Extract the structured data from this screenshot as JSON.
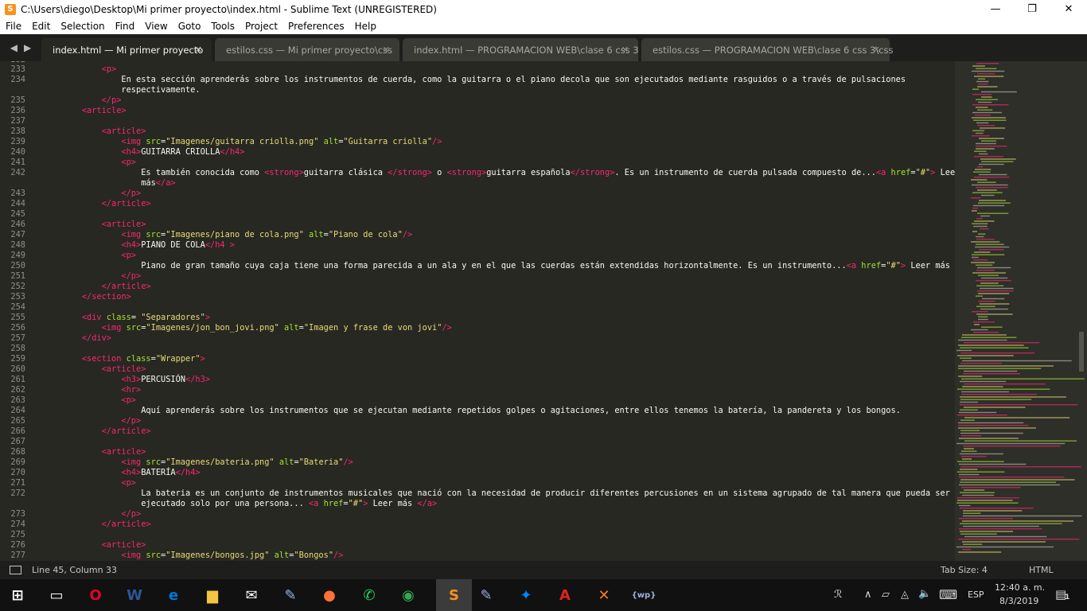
{
  "window": {
    "title": "C:\\Users\\diego\\Desktop\\Mi primer proyecto\\index.html - Sublime Text (UNREGISTERED)",
    "app_icon": "S",
    "minimize_glyph": "—",
    "maximize_glyph": "❐",
    "close_glyph": "✕"
  },
  "menu": [
    "File",
    "Edit",
    "Selection",
    "Find",
    "View",
    "Goto",
    "Tools",
    "Project",
    "Preferences",
    "Help"
  ],
  "nav": {
    "back": "◀",
    "forward": "▶"
  },
  "tabs": [
    {
      "label": "index.html — Mi primer proyecto",
      "active": true
    },
    {
      "label": "estilos.css — Mi primer proyecto\\css",
      "active": false
    },
    {
      "label": "index.html — PROGRAMACION  WEB\\clase 6 css 3",
      "active": false
    },
    {
      "label": "estilos.css — PROGRAMACION  WEB\\clase 6 css 3\\css",
      "active": false
    }
  ],
  "tab_close": "✕",
  "editor": {
    "first_partial_line": "232",
    "lines": [
      {
        "n": "233",
        "segs": [
          {
            "t": "        "
          },
          {
            "t": "<",
            "c": "t"
          },
          {
            "t": "p",
            "c": "t"
          },
          {
            "t": ">",
            "c": "t"
          }
        ]
      },
      {
        "n": "234",
        "segs": [
          {
            "t": "            En esta sección aprenderás sobre los instrumentos de cuerda, como la guitarra o el piano decola que son ejecutados mediante rasguidos o a través de pulsaciones"
          }
        ]
      },
      {
        "n": "",
        "segs": [
          {
            "t": "            respectivamente."
          }
        ]
      },
      {
        "n": "235",
        "segs": [
          {
            "t": "        "
          },
          {
            "t": "</p>",
            "c": "t"
          }
        ]
      },
      {
        "n": "236",
        "segs": [
          {
            "t": "    "
          },
          {
            "t": "<article>",
            "c": "t"
          }
        ]
      },
      {
        "n": "237",
        "segs": [
          {
            "t": ""
          }
        ]
      },
      {
        "n": "238",
        "segs": [
          {
            "t": "        "
          },
          {
            "t": "<article>",
            "c": "t"
          }
        ]
      },
      {
        "n": "239",
        "segs": [
          {
            "t": "            "
          },
          {
            "t": "<img",
            "c": "t"
          },
          {
            "t": " "
          },
          {
            "t": "src",
            "c": "a"
          },
          {
            "t": "="
          },
          {
            "t": "\"Imagenes/guitarra criolla.png\"",
            "c": "s"
          },
          {
            "t": " "
          },
          {
            "t": "alt",
            "c": "a"
          },
          {
            "t": "="
          },
          {
            "t": "\"Guitarra criolla\"",
            "c": "s"
          },
          {
            "t": "/>",
            "c": "t"
          }
        ]
      },
      {
        "n": "240",
        "segs": [
          {
            "t": "            "
          },
          {
            "t": "<h4>",
            "c": "t"
          },
          {
            "t": "GUITARRA CRIOLLA"
          },
          {
            "t": "</h4>",
            "c": "t"
          }
        ]
      },
      {
        "n": "241",
        "segs": [
          {
            "t": "            "
          },
          {
            "t": "<p>",
            "c": "t"
          }
        ]
      },
      {
        "n": "242",
        "segs": [
          {
            "t": "                Es también conocida como "
          },
          {
            "t": "<strong>",
            "c": "t"
          },
          {
            "t": "guitarra clásica "
          },
          {
            "t": "</strong>",
            "c": "t"
          },
          {
            "t": " o "
          },
          {
            "t": "<strong>",
            "c": "t"
          },
          {
            "t": "guitarra española"
          },
          {
            "t": "</strong>",
            "c": "t"
          },
          {
            "t": ". Es un instrumento de cuerda pulsada compuesto de..."
          },
          {
            "t": "<a",
            "c": "t"
          },
          {
            "t": " "
          },
          {
            "t": "href",
            "c": "a"
          },
          {
            "t": "="
          },
          {
            "t": "\"#\"",
            "c": "s"
          },
          {
            "t": ">",
            "c": "t"
          },
          {
            "t": " Leer"
          }
        ]
      },
      {
        "n": "",
        "segs": [
          {
            "t": "                más"
          },
          {
            "t": "</a>",
            "c": "t"
          }
        ]
      },
      {
        "n": "243",
        "segs": [
          {
            "t": "            "
          },
          {
            "t": "</p>",
            "c": "t"
          }
        ]
      },
      {
        "n": "244",
        "segs": [
          {
            "t": "        "
          },
          {
            "t": "</article>",
            "c": "t"
          }
        ]
      },
      {
        "n": "245",
        "segs": [
          {
            "t": ""
          }
        ]
      },
      {
        "n": "246",
        "segs": [
          {
            "t": "        "
          },
          {
            "t": "<article>",
            "c": "t"
          }
        ]
      },
      {
        "n": "247",
        "segs": [
          {
            "t": "            "
          },
          {
            "t": "<img",
            "c": "t"
          },
          {
            "t": " "
          },
          {
            "t": "src",
            "c": "a"
          },
          {
            "t": "="
          },
          {
            "t": "\"Imagenes/piano de cola.png\"",
            "c": "s"
          },
          {
            "t": " "
          },
          {
            "t": "alt",
            "c": "a"
          },
          {
            "t": "="
          },
          {
            "t": "\"Piano de cola\"",
            "c": "s"
          },
          {
            "t": "/>",
            "c": "t"
          }
        ]
      },
      {
        "n": "248",
        "segs": [
          {
            "t": "            "
          },
          {
            "t": "<h4>",
            "c": "t"
          },
          {
            "t": "PIANO DE COLA"
          },
          {
            "t": "</h4 >",
            "c": "t"
          }
        ]
      },
      {
        "n": "249",
        "segs": [
          {
            "t": "            "
          },
          {
            "t": "<p>",
            "c": "t"
          }
        ]
      },
      {
        "n": "250",
        "segs": [
          {
            "t": "                Piano de gran tamaño cuya caja tiene una forma parecida a un ala y en el que las cuerdas están extendidas horizontalmente. Es un instrumento..."
          },
          {
            "t": "<a",
            "c": "t"
          },
          {
            "t": " "
          },
          {
            "t": "href",
            "c": "a"
          },
          {
            "t": "="
          },
          {
            "t": "\"#\"",
            "c": "s"
          },
          {
            "t": ">",
            "c": "t"
          },
          {
            "t": " Leer más "
          },
          {
            "t": "</a>",
            "c": "t"
          }
        ]
      },
      {
        "n": "251",
        "segs": [
          {
            "t": "            "
          },
          {
            "t": "</p>",
            "c": "t"
          }
        ]
      },
      {
        "n": "252",
        "segs": [
          {
            "t": "        "
          },
          {
            "t": "</article>",
            "c": "t"
          }
        ]
      },
      {
        "n": "253",
        "segs": [
          {
            "t": "    "
          },
          {
            "t": "</section>",
            "c": "t"
          }
        ]
      },
      {
        "n": "254",
        "segs": [
          {
            "t": ""
          }
        ]
      },
      {
        "n": "255",
        "segs": [
          {
            "t": "    "
          },
          {
            "t": "<div",
            "c": "t"
          },
          {
            "t": " "
          },
          {
            "t": "class",
            "c": "a"
          },
          {
            "t": "= "
          },
          {
            "t": "\"Separadores\"",
            "c": "s"
          },
          {
            "t": ">",
            "c": "t"
          }
        ]
      },
      {
        "n": "256",
        "segs": [
          {
            "t": "        "
          },
          {
            "t": "<img",
            "c": "t"
          },
          {
            "t": " "
          },
          {
            "t": "src",
            "c": "a"
          },
          {
            "t": "="
          },
          {
            "t": "\"Imagenes/jon_bon_jovi.png\"",
            "c": "s"
          },
          {
            "t": " "
          },
          {
            "t": "alt",
            "c": "a"
          },
          {
            "t": "="
          },
          {
            "t": "\"Imagen y frase de von jovi\"",
            "c": "s"
          },
          {
            "t": "/>",
            "c": "t"
          }
        ]
      },
      {
        "n": "257",
        "segs": [
          {
            "t": "    "
          },
          {
            "t": "</div>",
            "c": "t"
          }
        ]
      },
      {
        "n": "258",
        "segs": [
          {
            "t": ""
          }
        ]
      },
      {
        "n": "259",
        "segs": [
          {
            "t": "    "
          },
          {
            "t": "<section",
            "c": "t"
          },
          {
            "t": " "
          },
          {
            "t": "class",
            "c": "a"
          },
          {
            "t": "="
          },
          {
            "t": "\"Wrapper\"",
            "c": "s"
          },
          {
            "t": ">",
            "c": "t"
          }
        ]
      },
      {
        "n": "260",
        "segs": [
          {
            "t": "        "
          },
          {
            "t": "<article>",
            "c": "t"
          }
        ]
      },
      {
        "n": "261",
        "segs": [
          {
            "t": "            "
          },
          {
            "t": "<h3>",
            "c": "t"
          },
          {
            "t": "PERCUSIÓN"
          },
          {
            "t": "</h3>",
            "c": "t"
          }
        ]
      },
      {
        "n": "262",
        "segs": [
          {
            "t": "            "
          },
          {
            "t": "<hr>",
            "c": "t"
          }
        ]
      },
      {
        "n": "263",
        "segs": [
          {
            "t": "            "
          },
          {
            "t": "<p>",
            "c": "t"
          }
        ]
      },
      {
        "n": "264",
        "segs": [
          {
            "t": "                Aquí aprenderás sobre los instrumentos que se ejecutan mediante repetidos golpes o agitaciones, entre ellos tenemos la batería, la pandereta y los bongos."
          }
        ]
      },
      {
        "n": "265",
        "segs": [
          {
            "t": "            "
          },
          {
            "t": "</p>",
            "c": "t"
          }
        ]
      },
      {
        "n": "266",
        "segs": [
          {
            "t": "        "
          },
          {
            "t": "</article>",
            "c": "t"
          }
        ]
      },
      {
        "n": "267",
        "segs": [
          {
            "t": ""
          }
        ]
      },
      {
        "n": "268",
        "segs": [
          {
            "t": "        "
          },
          {
            "t": "<article>",
            "c": "t"
          }
        ]
      },
      {
        "n": "269",
        "segs": [
          {
            "t": "            "
          },
          {
            "t": "<img",
            "c": "t"
          },
          {
            "t": " "
          },
          {
            "t": "src",
            "c": "a"
          },
          {
            "t": "="
          },
          {
            "t": "\"Imagenes/bateria.png\"",
            "c": "s"
          },
          {
            "t": " "
          },
          {
            "t": "alt",
            "c": "a"
          },
          {
            "t": "="
          },
          {
            "t": "\"Bateria\"",
            "c": "s"
          },
          {
            "t": "/>",
            "c": "t"
          }
        ]
      },
      {
        "n": "270",
        "segs": [
          {
            "t": "            "
          },
          {
            "t": "<h4>",
            "c": "t"
          },
          {
            "t": "BATERÍA"
          },
          {
            "t": "</h4>",
            "c": "t"
          }
        ]
      },
      {
        "n": "271",
        "segs": [
          {
            "t": "            "
          },
          {
            "t": "<p>",
            "c": "t"
          }
        ]
      },
      {
        "n": "272",
        "segs": [
          {
            "t": "                La bateria es un conjunto de instrumentos musicales que nació con la necesidad de producir diferentes percusiones en un sistema agrupado de tal manera que pueda ser"
          }
        ]
      },
      {
        "n": "",
        "segs": [
          {
            "t": "                ejecutado solo por una persona... "
          },
          {
            "t": "<a",
            "c": "t"
          },
          {
            "t": " "
          },
          {
            "t": "href",
            "c": "a"
          },
          {
            "t": "="
          },
          {
            "t": "\"#\"",
            "c": "s"
          },
          {
            "t": ">",
            "c": "t"
          },
          {
            "t": " Leer más "
          },
          {
            "t": "</a>",
            "c": "t"
          }
        ]
      },
      {
        "n": "273",
        "segs": [
          {
            "t": "            "
          },
          {
            "t": "</p>",
            "c": "t"
          }
        ]
      },
      {
        "n": "274",
        "segs": [
          {
            "t": "        "
          },
          {
            "t": "</article>",
            "c": "t"
          }
        ]
      },
      {
        "n": "275",
        "segs": [
          {
            "t": ""
          }
        ]
      },
      {
        "n": "276",
        "segs": [
          {
            "t": "        "
          },
          {
            "t": "<article>",
            "c": "t"
          }
        ]
      },
      {
        "n": "277",
        "segs": [
          {
            "t": "            "
          },
          {
            "t": "<img",
            "c": "t"
          },
          {
            "t": " "
          },
          {
            "t": "src",
            "c": "a"
          },
          {
            "t": "="
          },
          {
            "t": "\"Imagenes/bongos.jpg\"",
            "c": "s"
          },
          {
            "t": " "
          },
          {
            "t": "alt",
            "c": "a"
          },
          {
            "t": "="
          },
          {
            "t": "\"Bongos\"",
            "c": "s"
          },
          {
            "t": "/>",
            "c": "t"
          }
        ]
      }
    ]
  },
  "statusbar": {
    "position": "Line 45, Column 33",
    "tab_size": "Tab Size: 4",
    "syntax": "HTML"
  },
  "taskbar": {
    "apps": [
      {
        "name": "start",
        "glyph": "⊞",
        "color": "#ffffff"
      },
      {
        "name": "task-view",
        "glyph": "▭",
        "color": "#ffffff"
      },
      {
        "name": "opera",
        "glyph": "O",
        "color": "#e4002b"
      },
      {
        "name": "word",
        "glyph": "W",
        "color": "#2b579a"
      },
      {
        "name": "edge",
        "glyph": "e",
        "color": "#0078d7"
      },
      {
        "name": "file-explorer",
        "glyph": "▆",
        "color": "#f4c542"
      },
      {
        "name": "mail",
        "glyph": "✉",
        "color": "#ffffff"
      },
      {
        "name": "paint",
        "glyph": "✎",
        "color": "#8fb8e8"
      },
      {
        "name": "firefox",
        "glyph": "●",
        "color": "#ff7139"
      },
      {
        "name": "whatsapp",
        "glyph": "✆",
        "color": "#25d366"
      },
      {
        "name": "chrome",
        "glyph": "◉",
        "color": "#34a853"
      },
      {
        "name": "sublime",
        "glyph": "S",
        "color": "#f7931e",
        "active": true
      },
      {
        "name": "editor",
        "glyph": "✎",
        "color": "#9aa9d8"
      },
      {
        "name": "messenger",
        "glyph": "✦",
        "color": "#0084ff"
      },
      {
        "name": "acrobat",
        "glyph": "A",
        "color": "#e2231a"
      },
      {
        "name": "xampp",
        "glyph": "✕",
        "color": "#fb7a24"
      },
      {
        "name": "wamp",
        "glyph": "{wp}",
        "color": "#9cb4d8"
      }
    ],
    "tray_people": "ℛ",
    "tray_chevron": "∧",
    "tray_network": "▱",
    "tray_wifi": "◬",
    "tray_volume": "🔈",
    "tray_keyboard": "⌨",
    "language": "ESP",
    "time": "12:40 a. m.",
    "date": "8/3/2019",
    "notifications_glyph": "▤",
    "notifications_count": "1"
  }
}
